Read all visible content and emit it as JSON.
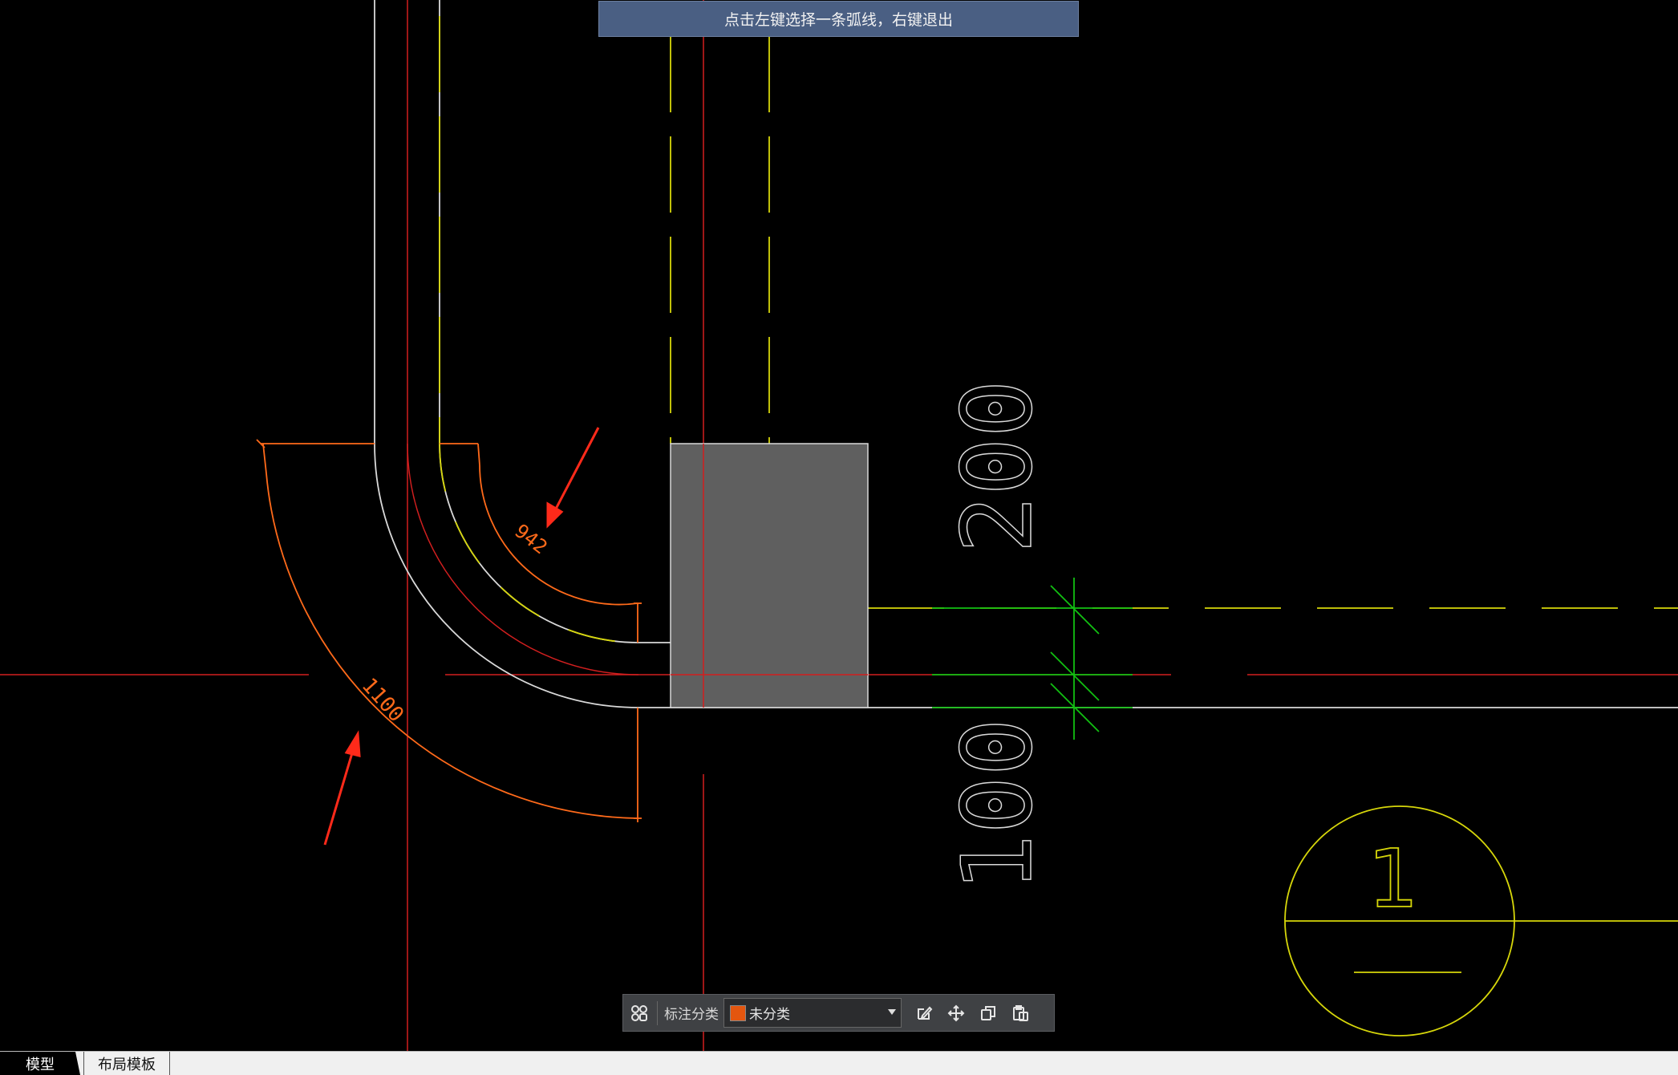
{
  "prompt": {
    "text": "点击左键选择一条弧线，右键退出"
  },
  "dimensions": {
    "inner_arc": "942",
    "outer_arc": "1100",
    "upper_thickness": "200",
    "lower_thickness": "100",
    "section_mark": "1"
  },
  "toolbar": {
    "category_label": "标注分类",
    "category_value": "未分类",
    "category_color": "#e4560f",
    "icons": [
      "grid-icon",
      "edit-icon",
      "move-icon",
      "copy-icon",
      "paste-icon"
    ]
  },
  "tabs": [
    {
      "label": "模型",
      "active": true
    },
    {
      "label": "布局模板",
      "active": false
    }
  ],
  "colors": {
    "background": "#000000",
    "wall_line": "#d9d9d9",
    "axis_line": "#d21f1f",
    "yellow_line": "#d6d60a",
    "dimension": "#ff6a1a",
    "green_dim": "#12c012",
    "column_fill": "#5f5f5f",
    "arrow": "#ff2a1a"
  }
}
